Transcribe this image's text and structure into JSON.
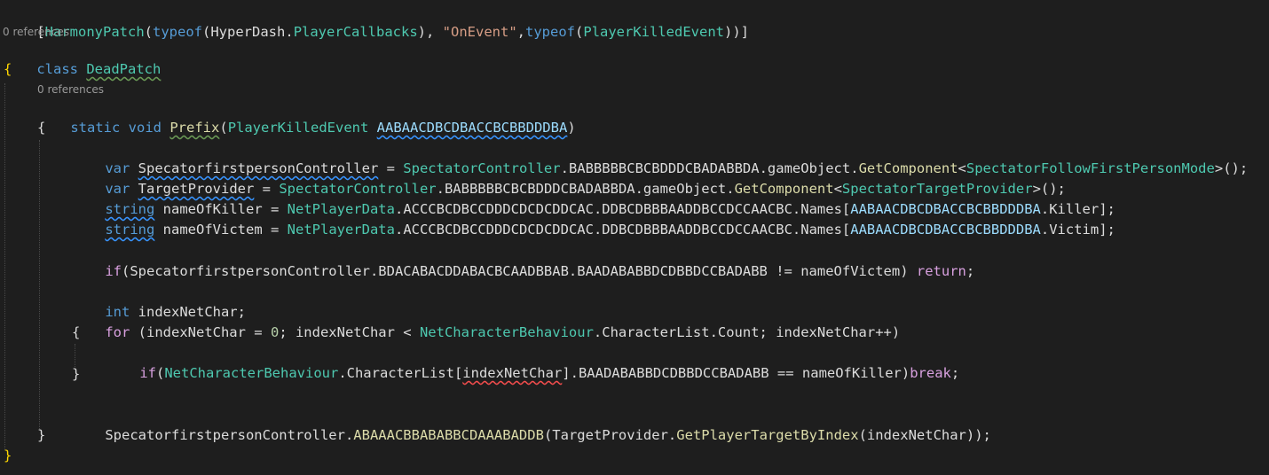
{
  "code": {
    "attr": {
      "open": "[",
      "name": "HarmonyPatch",
      "lp": "(",
      "kw_typeof1": "typeof",
      "lp2": "(",
      "ns": "HyperDash",
      "dot": ".",
      "type1": "PlayerCallbacks",
      "rp_comma": "), ",
      "str": "\"OnEvent\"",
      "comma": ",",
      "kw_typeof2": "typeof",
      "lp3": "(",
      "type2": "PlayerKilledEvent",
      "close": "))]"
    },
    "lens1": "0 references",
    "class_line": {
      "kw": "class",
      "sp": " ",
      "name": "DeadPatch"
    },
    "brace_open": "{",
    "lens2": "0 references",
    "method_line": {
      "kw_static": "static",
      "sp1": " ",
      "kw_void": "void",
      "sp2": " ",
      "name": "Prefix",
      "lp": "(",
      "ptype": "PlayerKilledEvent",
      "sp3": " ",
      "pname": "AABAACDBCDBACCBCBBDDDBA",
      "rp": ")"
    },
    "brace_method_open": "{",
    "l1": {
      "kw": "var",
      "sp": " ",
      "name": "SpecatorfirstpersonController",
      "eq": " = ",
      "type": "SpectatorController",
      "mid": ".BABBBBBCBCBDDDCBADABBDA.gameObject.",
      "fn": "GetComponent",
      "lt": "<",
      "generic": "SpectatorFollowFirstPersonMode",
      "end": ">();"
    },
    "l2": {
      "kw": "var",
      "sp": " ",
      "name": "TargetProvider",
      "eq": " = ",
      "type": "SpectatorController",
      "mid": ".BABBBBBCBCBDDDCBADABBDA.gameObject.",
      "fn": "GetComponent",
      "lt": "<",
      "generic": "SpectatorTargetProvider",
      "end": ">();"
    },
    "l3": {
      "kw": "string",
      "sp": " ",
      "name": "nameOfKiller",
      "eq": " = ",
      "type": "NetPlayerData",
      "mid": ".ACCCBCDBCCDDDCDCDCDDCAC.DDBCDBBBAADDBCCDCCAACBC.Names[",
      "param": "AABAACDBCDBACCBCBBDDDBA",
      "end": ".Killer];"
    },
    "l4": {
      "kw": "string",
      "sp": " ",
      "name": "nameOfVictem",
      "eq": " = ",
      "type": "NetPlayerData",
      "mid": ".ACCCBCDBCCDDDCDCDCDDCAC.DDBCDBBBAADDBCCDCCAACBC.Names[",
      "param": "AABAACDBCDBACCBCBBDDDBA",
      "end": ".Victim];"
    },
    "if1": {
      "kw": "if",
      "lp": "(",
      "body": "SpecatorfirstpersonController.BDACABACDDABACBCAADBBAB.BAADABABBDCDBBDCCBADABB != nameOfVictem) ",
      "ret": "return",
      "end": ";"
    },
    "int_line": {
      "kw": "int",
      "rest": " indexNetChar;"
    },
    "for_line": {
      "kw": "for",
      "a": " (indexNetChar = ",
      "zero": "0",
      "b": "; indexNetChar < ",
      "type": "NetCharacterBehaviour",
      "c": ".CharacterList.Count; indexNetChar++)"
    },
    "for_open": "{",
    "if2": {
      "kw": "if",
      "lp": "(",
      "type": "NetCharacterBehaviour",
      "a": ".CharacterList[",
      "idx": "indexNetChar",
      "b": "].BAADABABBDCDBBDCCBADABB == nameOfKiller)",
      "brk": "break",
      "end": ";"
    },
    "for_close": "}",
    "last": {
      "obj": "SpecatorfirstpersonController",
      "dot": ".",
      "fn": "ABAAACBBABABBCDAAABADDB",
      "lp": "(",
      "a": "TargetProvider.",
      "fn2": "GetPlayerTargetByIndex",
      "b": "(indexNetChar));"
    },
    "brace_method_close": "}",
    "brace_class_close": "}"
  }
}
